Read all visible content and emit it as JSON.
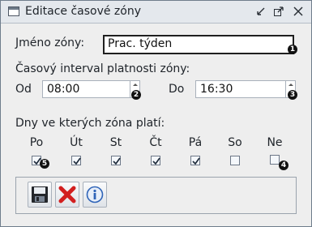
{
  "window": {
    "title": "Editace časové zóny"
  },
  "form": {
    "name_label": "Jméno zóny:",
    "name_value": "Prac. týden",
    "interval_heading": "Časový interval platnosti zóny:",
    "from_label": "Od",
    "from_value": "08:00",
    "to_label": "Do",
    "to_value": "16:30",
    "days_heading": "Dny ve kterých zóna platí:"
  },
  "days": [
    {
      "label": "Po",
      "checked": true
    },
    {
      "label": "Út",
      "checked": true
    },
    {
      "label": "St",
      "checked": true
    },
    {
      "label": "Čt",
      "checked": true
    },
    {
      "label": "Pá",
      "checked": true
    },
    {
      "label": "So",
      "checked": false
    },
    {
      "label": "Ne",
      "checked": false
    }
  ],
  "callouts": [
    "1",
    "2",
    "3",
    "4",
    "5"
  ],
  "toolbar": {
    "buttons": [
      {
        "icon": "floppy-save-icon"
      },
      {
        "icon": "red-x-cancel-icon"
      },
      {
        "icon": "info-icon"
      }
    ]
  },
  "colors": {
    "accent_red": "#d21f1f",
    "info_blue": "#2f64b8"
  }
}
